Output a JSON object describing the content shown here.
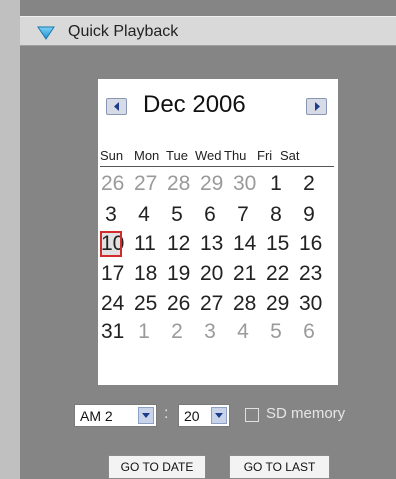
{
  "panel": {
    "title": "Quick Playback",
    "icon": "collapse-triangle-icon"
  },
  "calendar": {
    "month_label": "Dec 2006",
    "prev_icon": "chevron-left-icon",
    "next_icon": "chevron-right-icon",
    "weekdays": [
      "Sun",
      "Mon",
      "Tue",
      "Wed",
      "Thu",
      "Fri",
      "Sat"
    ],
    "weeks": [
      [
        "26",
        "27",
        "28",
        "29",
        "30",
        "1",
        "2"
      ],
      [
        "3",
        "4",
        "5",
        "6",
        "7",
        "8",
        "9"
      ],
      [
        "10",
        "11",
        "12",
        "13",
        "14",
        "15",
        "16"
      ],
      [
        "17",
        "18",
        "19",
        "20",
        "21",
        "22",
        "23"
      ],
      [
        "24",
        "25",
        "26",
        "27",
        "28",
        "29",
        "30"
      ],
      [
        "31",
        "1",
        "2",
        "3",
        "4",
        "5",
        "6"
      ]
    ],
    "selected_day": "10"
  },
  "time": {
    "hour_value": "AM 2",
    "minute_value": "20",
    "separator": ":"
  },
  "sd_memory": {
    "label": "SD memory",
    "checked": false
  },
  "buttons": {
    "go_to_date": "GO TO DATE",
    "go_to_last": "GO TO LAST"
  }
}
